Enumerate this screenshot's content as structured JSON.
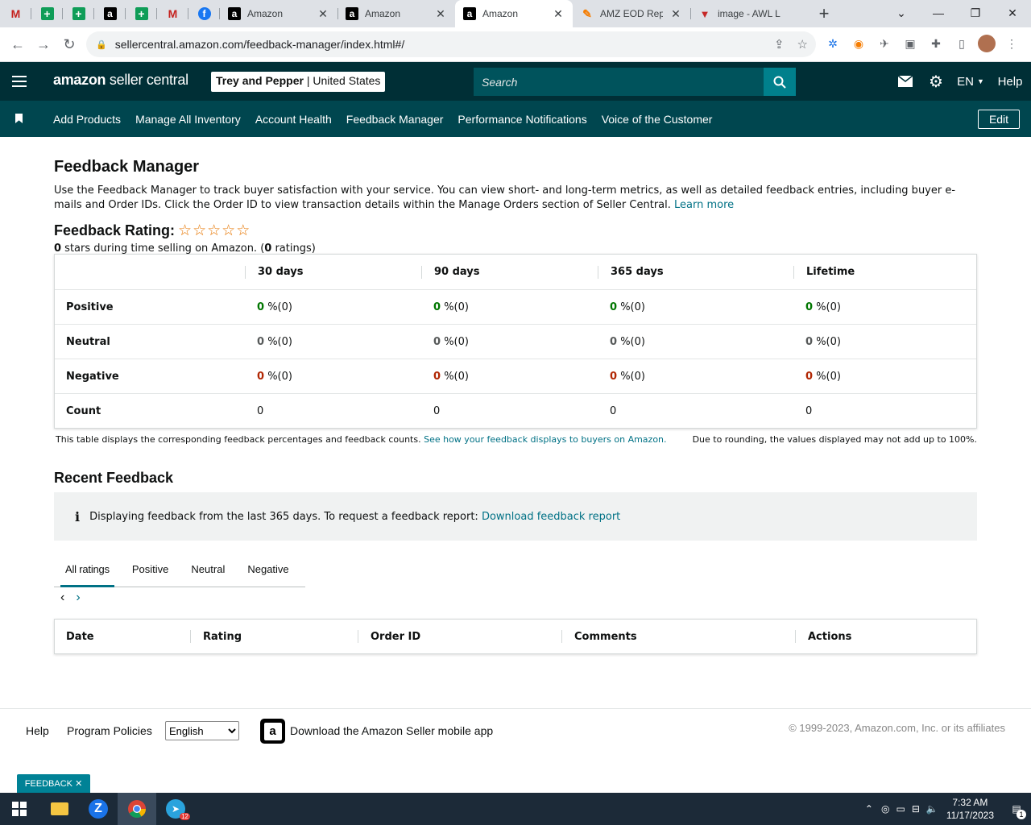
{
  "browser": {
    "tabs": [
      {
        "title": "Amazon",
        "icon": "amazon-icon"
      },
      {
        "title": "Amazon",
        "icon": "amazon-icon"
      },
      {
        "title": "Amazon",
        "icon": "amazon-icon",
        "active": true
      },
      {
        "title": "AMZ EOD Rep",
        "icon": "amz-eod-icon"
      },
      {
        "title": "image - AWL L",
        "icon": "awl-icon"
      }
    ],
    "url": "sellercentral.amazon.com/feedback-manager/index.html#/"
  },
  "header": {
    "logo_main": "amazon",
    "logo_sub": "seller central",
    "store_name": "Trey and Pepper",
    "store_region": "United States",
    "search_placeholder": "Search",
    "language": "EN",
    "help": "Help"
  },
  "nav": {
    "links": [
      "Add Products",
      "Manage All Inventory",
      "Account Health",
      "Feedback Manager",
      "Performance Notifications",
      "Voice of the Customer"
    ],
    "edit": "Edit"
  },
  "page": {
    "title": "Feedback Manager",
    "description": "Use the Feedback Manager to track buyer satisfaction with your service. You can view short- and long-term metrics, as well as detailed feedback entries, including buyer e-mails and Order IDs. Click the Order ID to view transaction details within the Manage Orders section of Seller Central.",
    "learn_more": "Learn more",
    "rating_label": "Feedback Rating:",
    "stars_count": "0",
    "stars_text": " stars during time selling on Amazon. (",
    "ratings_count": "0",
    "ratings_text": " ratings)"
  },
  "feedback_table": {
    "columns": [
      "30 days",
      "90 days",
      "365 days",
      "Lifetime"
    ],
    "rows": [
      {
        "label": "Positive",
        "values": [
          "0",
          "0",
          "0",
          "0"
        ],
        "suffix": "%(0)"
      },
      {
        "label": "Neutral",
        "values": [
          "0",
          "0",
          "0",
          "0"
        ],
        "suffix": "%(0)"
      },
      {
        "label": "Negative",
        "values": [
          "0",
          "0",
          "0",
          "0"
        ],
        "suffix": "%(0)"
      },
      {
        "label": "Count",
        "values": [
          "0",
          "0",
          "0",
          "0"
        ]
      }
    ],
    "note": "This table displays the corresponding feedback percentages and feedback counts.",
    "note_link": "See how your feedback displays to buyers on Amazon.",
    "rounding_note": "Due to rounding, the values displayed may not add up to 100%."
  },
  "recent": {
    "title": "Recent Feedback",
    "info": "Displaying feedback from the last 365 days. To request a feedback report:",
    "info_link": "Download feedback report",
    "tabs": [
      "All ratings",
      "Positive",
      "Neutral",
      "Negative"
    ],
    "columns": [
      "Date",
      "Rating",
      "Order ID",
      "Comments",
      "Actions"
    ]
  },
  "footer": {
    "help": "Help",
    "policies": "Program Policies",
    "language": "English",
    "app": "Download the Amazon Seller mobile app",
    "copyright": "© 1999-2023, Amazon.com, Inc. or its affiliates",
    "feedback_tab": "FEEDBACK"
  },
  "taskbar": {
    "time": "7:32 AM",
    "date": "11/17/2023",
    "telegram_badge": "12",
    "notif_count": "1"
  },
  "colors": {
    "header_bg": "#002f36",
    "nav_bg": "#00464f",
    "link": "#007185",
    "positive": "#007600",
    "negative": "#b12704"
  }
}
